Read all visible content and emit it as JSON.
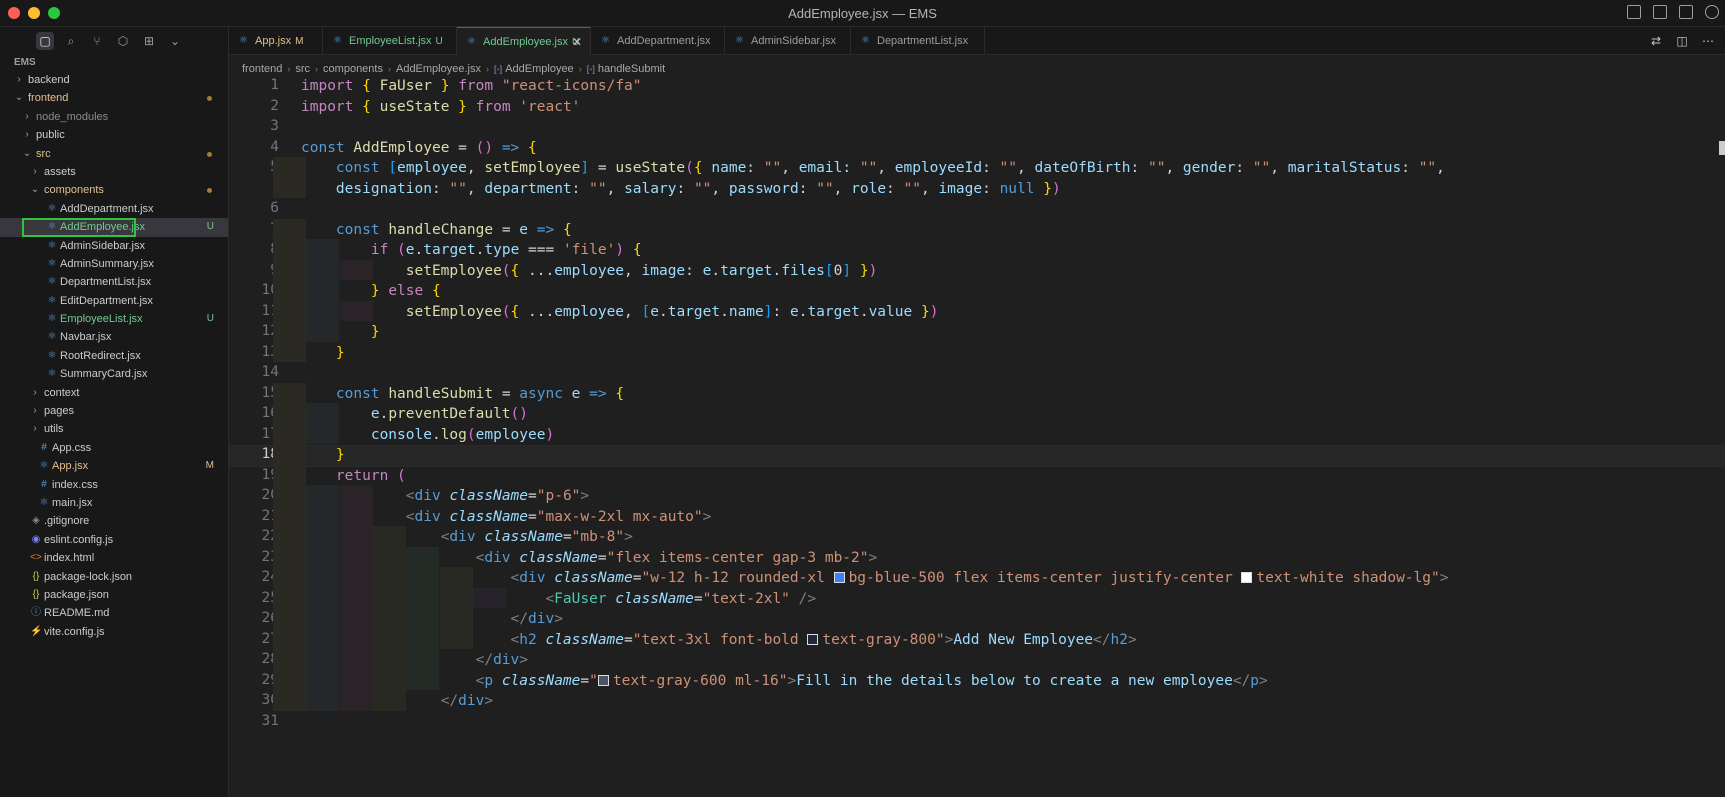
{
  "window": {
    "title": "AddEmployee.jsx — EMS"
  },
  "explorer": {
    "root": "EMS",
    "items": [
      {
        "label": "backend",
        "kind": "folder",
        "depth": 0,
        "open": false
      },
      {
        "label": "frontend",
        "kind": "folder",
        "depth": 0,
        "open": true,
        "status": "dot"
      },
      {
        "label": "node_modules",
        "kind": "folder",
        "depth": 1,
        "open": false,
        "dim": true
      },
      {
        "label": "public",
        "kind": "folder",
        "depth": 1,
        "open": false
      },
      {
        "label": "src",
        "kind": "folder",
        "depth": 1,
        "open": true,
        "status": "dot"
      },
      {
        "label": "assets",
        "kind": "folder",
        "depth": 2,
        "open": false
      },
      {
        "label": "components",
        "kind": "folder",
        "depth": 2,
        "open": true,
        "status": "dot"
      },
      {
        "label": "AddDepartment.jsx",
        "kind": "jsx",
        "depth": 3
      },
      {
        "label": "AddEmployee.jsx",
        "kind": "jsx",
        "depth": 3,
        "badge": "U",
        "selected": true
      },
      {
        "label": "AdminSidebar.jsx",
        "kind": "jsx",
        "depth": 3
      },
      {
        "label": "AdminSummary.jsx",
        "kind": "jsx",
        "depth": 3
      },
      {
        "label": "DepartmentList.jsx",
        "kind": "jsx",
        "depth": 3
      },
      {
        "label": "EditDepartment.jsx",
        "kind": "jsx",
        "depth": 3
      },
      {
        "label": "EmployeeList.jsx",
        "kind": "jsx",
        "depth": 3,
        "badge": "U"
      },
      {
        "label": "Navbar.jsx",
        "kind": "jsx",
        "depth": 3
      },
      {
        "label": "RootRedirect.jsx",
        "kind": "jsx",
        "depth": 3
      },
      {
        "label": "SummaryCard.jsx",
        "kind": "jsx",
        "depth": 3
      },
      {
        "label": "context",
        "kind": "folder",
        "depth": 2,
        "open": false
      },
      {
        "label": "pages",
        "kind": "folder",
        "depth": 2,
        "open": false
      },
      {
        "label": "utils",
        "kind": "folder",
        "depth": 2,
        "open": false
      },
      {
        "label": "App.css",
        "kind": "css",
        "depth": 2
      },
      {
        "label": "App.jsx",
        "kind": "jsx",
        "depth": 2,
        "badge": "M"
      },
      {
        "label": "index.css",
        "kind": "css",
        "depth": 2
      },
      {
        "label": "main.jsx",
        "kind": "jsx",
        "depth": 2
      },
      {
        "label": ".gitignore",
        "kind": "git",
        "depth": 1
      },
      {
        "label": "eslint.config.js",
        "kind": "eslint",
        "depth": 1
      },
      {
        "label": "index.html",
        "kind": "html",
        "depth": 1
      },
      {
        "label": "package-lock.json",
        "kind": "json",
        "depth": 1
      },
      {
        "label": "package.json",
        "kind": "json",
        "depth": 1
      },
      {
        "label": "README.md",
        "kind": "md",
        "depth": 1
      },
      {
        "label": "vite.config.js",
        "kind": "vite",
        "depth": 1
      }
    ]
  },
  "tabs": [
    {
      "label": "App.jsx",
      "mark": "M",
      "active": false
    },
    {
      "label": "EmployeeList.jsx",
      "mark": "U",
      "active": false
    },
    {
      "label": "AddEmployee.jsx",
      "mark": "U",
      "active": true
    },
    {
      "label": "AddDepartment.jsx",
      "mark": "",
      "active": false
    },
    {
      "label": "AdminSidebar.jsx",
      "mark": "",
      "active": false
    },
    {
      "label": "DepartmentList.jsx",
      "mark": "",
      "active": false
    }
  ],
  "breadcrumb": [
    "frontend",
    "src",
    "components",
    "AddEmployee.jsx",
    "AddEmployee",
    "handleSubmit"
  ],
  "editor": {
    "current_line": 18,
    "line_numbers": [
      "1",
      "2",
      "3",
      "4",
      "5",
      "",
      "6",
      "7",
      "8",
      "9",
      "10",
      "11",
      "12",
      "13",
      "14",
      "15",
      "16",
      "17",
      "18",
      "19",
      "20",
      "21",
      "22",
      "23",
      "24",
      "25",
      "26",
      "27",
      "28",
      "29",
      "30",
      "31"
    ],
    "lines": [
      "import { FaUser } from \"react-icons/fa\"",
      "import { useState } from 'react'",
      "",
      "const AddEmployee = () => {",
      "    const [employee, setEmployee] = useState({ name: \"\", email: \"\", employeeId: \"\", dateOfBirth: \"\", gender: \"\", maritalStatus: \"\",",
      "    designation: \"\", department: \"\", salary: \"\", password: \"\", role: \"\", image: null })",
      "",
      "    const handleChange = e => {",
      "        if (e.target.type === 'file') {",
      "            setEmployee({ ...employee, image: e.target.files[0] })",
      "        } else {",
      "            setEmployee({ ...employee, [e.target.name]: e.target.value })",
      "        }",
      "    }",
      "",
      "    const handleSubmit = async e => {",
      "        e.preventDefault()",
      "        console.log(employee)",
      "    }",
      "    return (",
      "            <div className=\"p-6\">",
      "            <div className=\"max-w-2xl mx-auto\">",
      "                <div className=\"mb-8\">",
      "                    <div className=\"flex items-center gap-3 mb-2\">",
      "                        <div className=\"w-12 h-12 rounded-xl bg-blue-500 flex items-center justify-center text-white shadow-lg\">",
      "                            <FaUser className=\"text-2xl\" />",
      "                        </div>",
      "                        <h2 className=\"text-3xl font-bold text-gray-800\">Add New Employee</h2>",
      "                    </div>",
      "                    <p className=\"text-gray-600 ml-16\">Fill in the details below to create a new employee</p>",
      "                </div>",
      ""
    ]
  },
  "colors": {
    "accent": "#0078d4",
    "selection_outline": "#2ec43f",
    "swatch_blue": "#3b82f6",
    "swatch_white": "#ffffff",
    "swatch_gray800": "#1f2937",
    "swatch_gray600": "#4b5563"
  }
}
